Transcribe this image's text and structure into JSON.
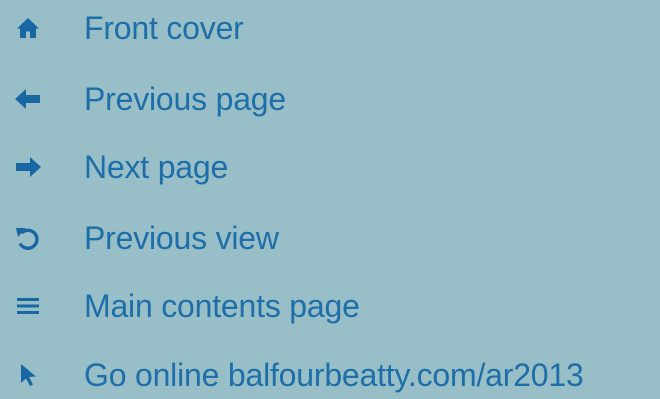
{
  "colors": {
    "background": "#98bfc7",
    "text": "#1d6ea9",
    "icon": "#1866a2"
  },
  "nav": {
    "items": [
      {
        "label": "Front cover",
        "icon": "home-icon"
      },
      {
        "label": "Previous page",
        "icon": "arrow-left-icon"
      },
      {
        "label": "Next page",
        "icon": "arrow-right-icon"
      },
      {
        "label": "Previous view",
        "icon": "undo-icon"
      },
      {
        "label": "Main contents page",
        "icon": "menu-icon"
      },
      {
        "label": "Go online balfourbeatty.com/ar2013",
        "icon": "cursor-icon"
      }
    ]
  }
}
